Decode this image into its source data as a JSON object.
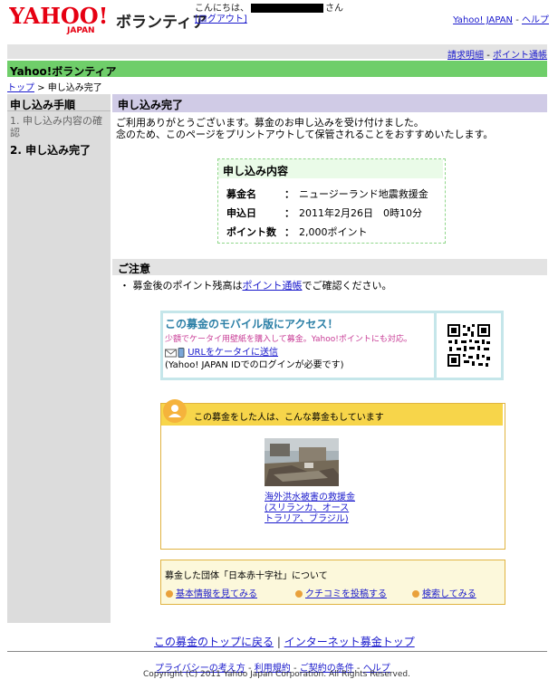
{
  "header": {
    "logo_text": "YAHOO!",
    "logo_sub": "JAPAN",
    "service_title": "ボランティア",
    "greeting_prefix": "こんにちは、",
    "greeting_suffix": "さん",
    "logout": "[ログアウト]",
    "nav_yahoo": "Yahoo! JAPAN",
    "nav_sep": " - ",
    "nav_help": "ヘルプ"
  },
  "subnav": {
    "statement": "請求明細",
    "sep": " - ",
    "points": "ポイント通帳"
  },
  "section_title": "Yahoo!ボランティア",
  "breadcrumb": {
    "top": "トップ",
    "arrow": " > ",
    "current": "申し込み完了"
  },
  "sidebar": {
    "heading": "申し込み手順",
    "step1": "1. 申し込み内容の確認",
    "step2": "2. 申し込み完了"
  },
  "main": {
    "title": "申し込み完了",
    "thanks_line1": "ご利用ありがとうございます。募金のお申し込みを受け付けました。",
    "thanks_line2": "念のため、このページをプリントアウトして保管されることをおすすめいたします。"
  },
  "summary": {
    "title": "申し込み内容",
    "rows": [
      {
        "label": "募金名",
        "value": "ニュージーランド地震救援金"
      },
      {
        "label": "申込日",
        "value": "2011年2月26日　0時10分"
      },
      {
        "label": "ポイント数",
        "value": "2,000ポイント"
      }
    ],
    "colon": "："
  },
  "notice": {
    "title": "ご注意",
    "text_pre": "・ 募金後のポイント残高は",
    "link": "ポイント通帳",
    "text_post": "でご確認ください。"
  },
  "mobile": {
    "title": "この募金のモバイル版にアクセス！",
    "subtitle": "少額でケータイ用壁紙を購入して募金。Yahoo!ポイントにも対応。",
    "send_link": "URLをケータイに送信",
    "note": "(Yahoo! JAPAN IDでのログインが必要です)"
  },
  "reco": {
    "title": "この募金をした人は、こんな募金もしています",
    "link": "海外洪水被害の救援金(スリランカ、オーストラリア、ブラジル)"
  },
  "org": {
    "title": "募金した団体「日本赤十字社」について",
    "links": [
      "基本情報を見てみる",
      "クチコミを投稿する",
      "検索してみる"
    ]
  },
  "footer": {
    "back_top": "この募金のトップに戻る",
    "sep": " | ",
    "internet_top": "インターネット募金トップ",
    "privacy": "プライバシーの考え方",
    "terms": "利用規約",
    "contract": "ご契約の条件",
    "help": "ヘルプ",
    "dash": " - ",
    "copyright": "Copyright (C) 2011 Yahoo Japan Corporation. All Rights Reserved."
  },
  "colors": {
    "green_bar": "#6fce6a",
    "purple_head": "#d0cbe6",
    "mobile_frame": "#c5e6ea",
    "reco_header": "#f7d54a",
    "link": "#1a1acc"
  }
}
